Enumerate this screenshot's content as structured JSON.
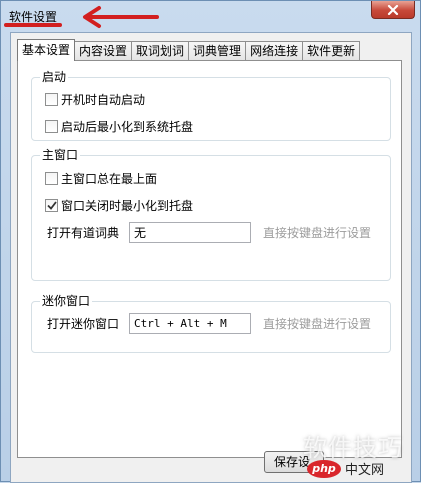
{
  "window": {
    "title": "软件设置"
  },
  "tabs": [
    {
      "label": "基本设置",
      "active": true
    },
    {
      "label": "内容设置",
      "active": false
    },
    {
      "label": "取词划词",
      "active": false
    },
    {
      "label": "词典管理",
      "active": false
    },
    {
      "label": "网络连接",
      "active": false
    },
    {
      "label": "软件更新",
      "active": false
    }
  ],
  "startup": {
    "label": "启动",
    "auto_start": {
      "label": "开机时自动启动",
      "checked": false
    },
    "minimize_to_tray": {
      "label": "启动后最小化到系统托盘",
      "checked": false
    }
  },
  "main_window": {
    "label": "主窗口",
    "always_on_top": {
      "label": "主窗口总在最上面",
      "checked": false
    },
    "close_to_tray": {
      "label": "窗口关闭时最小化到托盘",
      "checked": true
    },
    "open_hotkey": {
      "label": "打开有道词典",
      "value": "无",
      "hint": "直接按键盘进行设置"
    }
  },
  "mini_window": {
    "label": "迷你窗口",
    "open_hotkey": {
      "label": "打开迷你窗口",
      "value": "Ctrl + Alt + M",
      "hint": "直接按键盘进行设置"
    }
  },
  "footer": {
    "save_label": "保存设"
  },
  "watermark": {
    "text": "软件技巧",
    "brand_logo": "php",
    "brand_name": "中文网"
  },
  "colors": {
    "annotation_red": "#d21f1f",
    "close_red": "#c7493a",
    "hint_gray": "#9c9c9c"
  }
}
